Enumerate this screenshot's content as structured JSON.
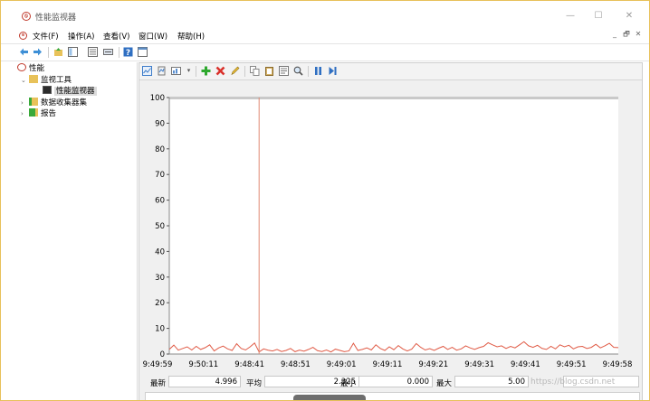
{
  "window": {
    "title": "性能监视器",
    "controls": {
      "minimize": "—",
      "maximize": "☐",
      "close": "✕"
    }
  },
  "menu": {
    "items": [
      "文件(F)",
      "操作(A)",
      "查看(V)",
      "窗口(W)",
      "帮助(H)"
    ],
    "mdi_controls": [
      "_",
      "🗗",
      "✕"
    ]
  },
  "tree": {
    "root": "性能",
    "items": [
      {
        "label": "监视工具",
        "expanded": true
      },
      {
        "label": "性能监视器",
        "selected": true
      },
      {
        "label": "数据收集器集"
      },
      {
        "label": "报告"
      }
    ]
  },
  "chart_data": {
    "type": "line",
    "y_ticks": [
      0,
      10,
      20,
      30,
      40,
      50,
      60,
      70,
      80,
      90,
      100
    ],
    "ylim": [
      0,
      100
    ],
    "x_tick_labels": [
      "9:49:59",
      "9:50:11",
      "9:48:41",
      "9:48:51",
      "9:49:01",
      "9:49:11",
      "9:49:21",
      "9:49:31",
      "9:49:41",
      "9:49:51",
      "9:49:58"
    ],
    "series": [
      {
        "color": "#e05a45",
        "values": [
          1.8,
          3.5,
          1.5,
          2.2,
          2.8,
          1.6,
          3.0,
          1.8,
          2.5,
          3.6,
          1.2,
          2.4,
          3.1,
          2.0,
          1.4,
          4.0,
          2.2,
          1.6,
          2.8,
          4.3,
          0.8,
          2.0,
          1.5,
          1.2,
          1.8,
          1.0,
          1.4,
          2.2,
          0.9,
          1.5,
          1.1,
          1.8,
          2.6,
          1.3,
          1.0,
          1.6,
          0.8,
          1.9,
          1.4,
          0.9,
          1.2,
          4.2,
          1.4,
          1.8,
          2.4,
          1.6,
          3.6,
          2.2,
          1.4,
          2.8,
          1.7,
          3.3,
          2.0,
          1.2,
          1.9,
          4.1,
          2.6,
          1.6,
          2.1,
          1.4,
          2.3,
          3.0,
          1.8,
          2.6,
          1.5,
          2.0,
          3.2,
          2.4,
          1.8,
          2.5,
          3.0,
          4.4,
          3.6,
          2.8,
          3.2,
          2.2,
          3.0,
          2.4,
          3.6,
          4.8,
          3.2,
          2.6,
          3.4,
          2.2,
          1.8,
          3.0,
          2.0,
          3.6,
          2.8,
          3.4,
          2.0,
          2.8,
          3.0,
          2.2,
          2.6,
          3.8,
          2.4,
          3.2,
          4.2,
          2.6,
          2.5
        ]
      }
    ],
    "cursor_index": 20,
    "grid": false
  },
  "stats": {
    "last_label": "最新",
    "last_value": "4.996",
    "avg_label": "平均",
    "avg_value": "2.325",
    "min_label": "最小",
    "min_value": "0.000",
    "max_label": "最大",
    "max_value": "5.00"
  },
  "watermark": "https://blog.csdn.net"
}
